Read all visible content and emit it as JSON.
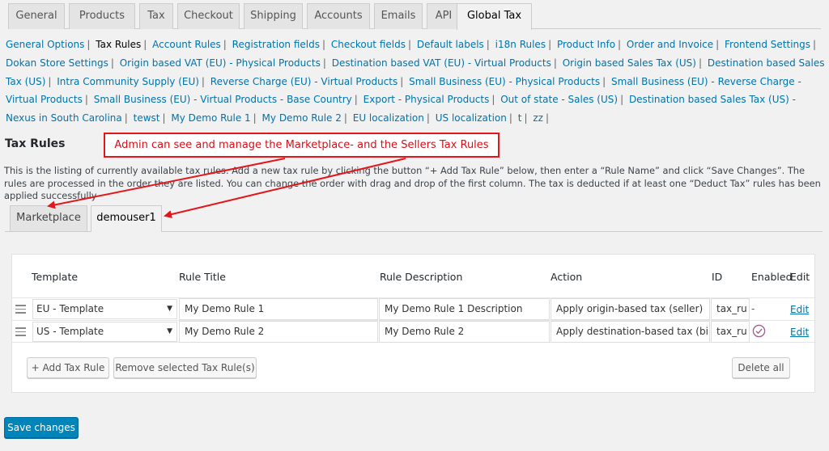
{
  "tabs": [
    "General",
    "Products",
    "Tax",
    "Checkout",
    "Shipping",
    "Accounts",
    "Emails",
    "API",
    "Global Tax"
  ],
  "active_tab": "Global Tax",
  "sublinks": [
    {
      "label": "General Options"
    },
    {
      "label": "Tax Rules",
      "current": true
    },
    {
      "label": "Account Rules"
    },
    {
      "label": "Registration fields"
    },
    {
      "label": "Checkout fields"
    },
    {
      "label": "Default labels"
    },
    {
      "label": "i18n Rules"
    },
    {
      "label": "Product Info"
    },
    {
      "label": "Order and Invoice"
    },
    {
      "label": "Frontend Settings"
    },
    {
      "label": "Dokan Store Settings"
    },
    {
      "label": "Origin based VAT (EU) - Physical Products"
    },
    {
      "label": "Destination based VAT (EU) - Virtual Products"
    },
    {
      "label": "Origin based Sales Tax (US)"
    },
    {
      "label": "Destination based Sales Tax (US)"
    },
    {
      "label": "Intra Community Supply (EU)"
    },
    {
      "label": "Reverse Charge (EU) - Virtual Products"
    },
    {
      "label": "Small Business (EU) - Physical Products"
    },
    {
      "label": "Small Business (EU) - Reverse Charge - Virtual Products"
    },
    {
      "label": "Small Business (EU) - Virtual Products - Base Country"
    },
    {
      "label": "Export - Physical Products"
    },
    {
      "label": "Out of state - Sales (US)"
    },
    {
      "label": "Destination based Sales Tax (US) - Nexus in South Carolina"
    },
    {
      "label": "tewst"
    },
    {
      "label": "My Demo Rule 1"
    },
    {
      "label": "My Demo Rule 2"
    },
    {
      "label": "EU localization"
    },
    {
      "label": "US localization"
    },
    {
      "label": "t"
    },
    {
      "label": "zz"
    }
  ],
  "section_title": "Tax Rules",
  "annotation": "Admin can see and manage the Marketplace- and the Sellers Tax Rules",
  "description": "This is the listing of currently available tax rules. Add a new tax rule by clicking the button “+ Add Tax Rule” below, then enter a “Rule Name” and click “Save Changes”. The rules are processed in the order they are listed. You can change the order with drag and drop of the first column. The tax is deducted if at least one “Deduct Tax” rules has been applied successfully",
  "inner_tabs": [
    "Marketplace",
    "demouser1"
  ],
  "active_inner_tab": "demouser1",
  "table": {
    "headers": {
      "template": "Template",
      "title": "Rule Title",
      "description": "Rule Description",
      "action": "Action",
      "id": "ID",
      "enabled": "Enabled",
      "edit": "Edit"
    },
    "rows": [
      {
        "template": "EU - Template",
        "title": "My Demo Rule 1",
        "description": "My Demo Rule 1 Description",
        "action": "Apply origin-based tax (seller)",
        "id": "tax_ru",
        "enabled": "-",
        "edit": "Edit"
      },
      {
        "template": "US - Template",
        "title": "My Demo Rule 2",
        "description": "My Demo Rule 2",
        "action": "Apply destination-based tax (bill",
        "id": "tax_ru",
        "enabled": "check",
        "edit": "Edit"
      }
    ]
  },
  "buttons": {
    "add": "+ Add Tax Rule",
    "remove": "Remove selected Tax Rule(s)",
    "delete_all": "Delete all",
    "save": "Save changes"
  },
  "colors": {
    "link": "#0073aa",
    "primary": "#0085ba",
    "annotation": "#e3161c",
    "check": "#9b5c8f"
  }
}
